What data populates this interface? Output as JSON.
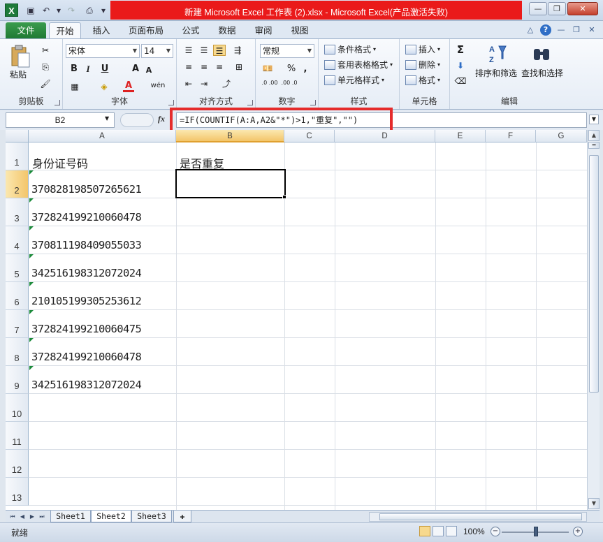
{
  "window": {
    "title": "新建 Microsoft Excel 工作表 (2).xlsx  -  Microsoft Excel(产品激活失败)"
  },
  "ribbon": {
    "file_tab": "文件",
    "tabs": [
      "开始",
      "插入",
      "页面布局",
      "公式",
      "数据",
      "审阅",
      "视图"
    ],
    "active_tab": "开始",
    "clipboard": {
      "paste": "粘贴",
      "label": "剪贴板"
    },
    "font": {
      "name": "宋体",
      "size": "14",
      "bold": "B",
      "italic": "I",
      "underline": "U",
      "grow": "A",
      "shrink": "A",
      "font_color": "A",
      "wen": "wén",
      "label": "字体"
    },
    "alignment": {
      "label": "对齐方式"
    },
    "number": {
      "format": "常规",
      "percent": "%",
      "comma": ",",
      "label": "数字",
      "inc": ".0 .00",
      "dec": ".00 .0"
    },
    "styles": {
      "cond": "条件格式",
      "table": "套用表格格式",
      "cell": "单元格样式",
      "label": "样式"
    },
    "cells": {
      "insert": "插入",
      "delete": "删除",
      "format": "格式",
      "label": "单元格"
    },
    "editing": {
      "sum": "Σ",
      "sort": "排序和筛选",
      "find": "查找和选择",
      "label": "编辑"
    }
  },
  "formula_bar": {
    "name_box": "B2",
    "fx": "fx",
    "formula": "=IF(COUNTIF(A:A,A2&\"*\")>1,\"重复\",\"\")"
  },
  "grid": {
    "columns": [
      "A",
      "B",
      "C",
      "D",
      "E",
      "F",
      "G"
    ],
    "selected_column": "B",
    "rows": [
      "1",
      "2",
      "3",
      "4",
      "5",
      "6",
      "7",
      "8",
      "9",
      "10",
      "11",
      "12",
      "13"
    ],
    "selected_row": "2",
    "cells": {
      "A1": "身份证号码",
      "B1": "是否重复",
      "A2": "370828198507265621",
      "A3": "372824199210060478",
      "A4": "370811198409055033",
      "A5": "342516198312072024",
      "A6": "210105199305253612",
      "A7": "372824199210060475",
      "A8": "372824199210060478",
      "A9": "342516198312072024"
    }
  },
  "sheets": {
    "tabs": [
      "Sheet1",
      "Sheet2",
      "Sheet3"
    ],
    "active": "Sheet2"
  },
  "status": {
    "text": "就绪",
    "zoom": "100%"
  }
}
